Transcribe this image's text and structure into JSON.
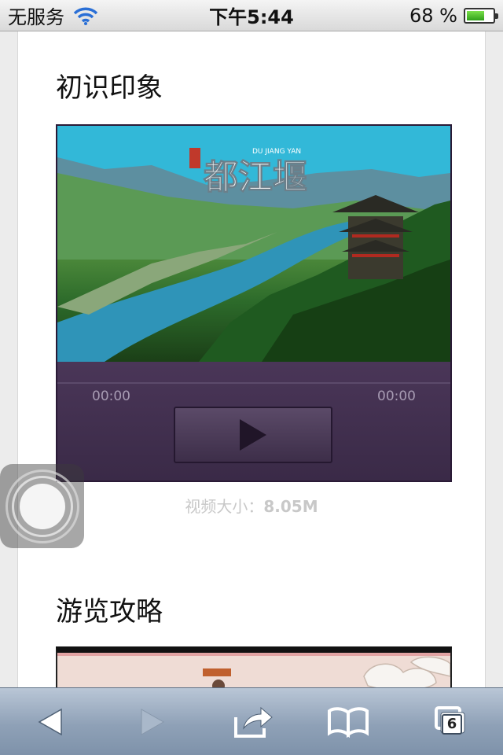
{
  "status_bar": {
    "carrier": "无服务",
    "time": "下午5:44",
    "battery_percent": "68 %",
    "battery_level": 0.68
  },
  "sections": [
    {
      "title": "初识印象"
    },
    {
      "title": "游览攻略"
    }
  ],
  "video": {
    "brand_text": "都江堰",
    "brand_subtext": "DU JIANG YAN",
    "current_time": "00:00",
    "total_time": "00:00",
    "size_label": "视频大小：",
    "size_value": "8.05M"
  },
  "toolbar": {
    "tab_count": "6",
    "icons": [
      "back-arrow-icon",
      "forward-arrow-icon",
      "share-icon",
      "bookmarks-icon",
      "tabs-icon"
    ]
  }
}
